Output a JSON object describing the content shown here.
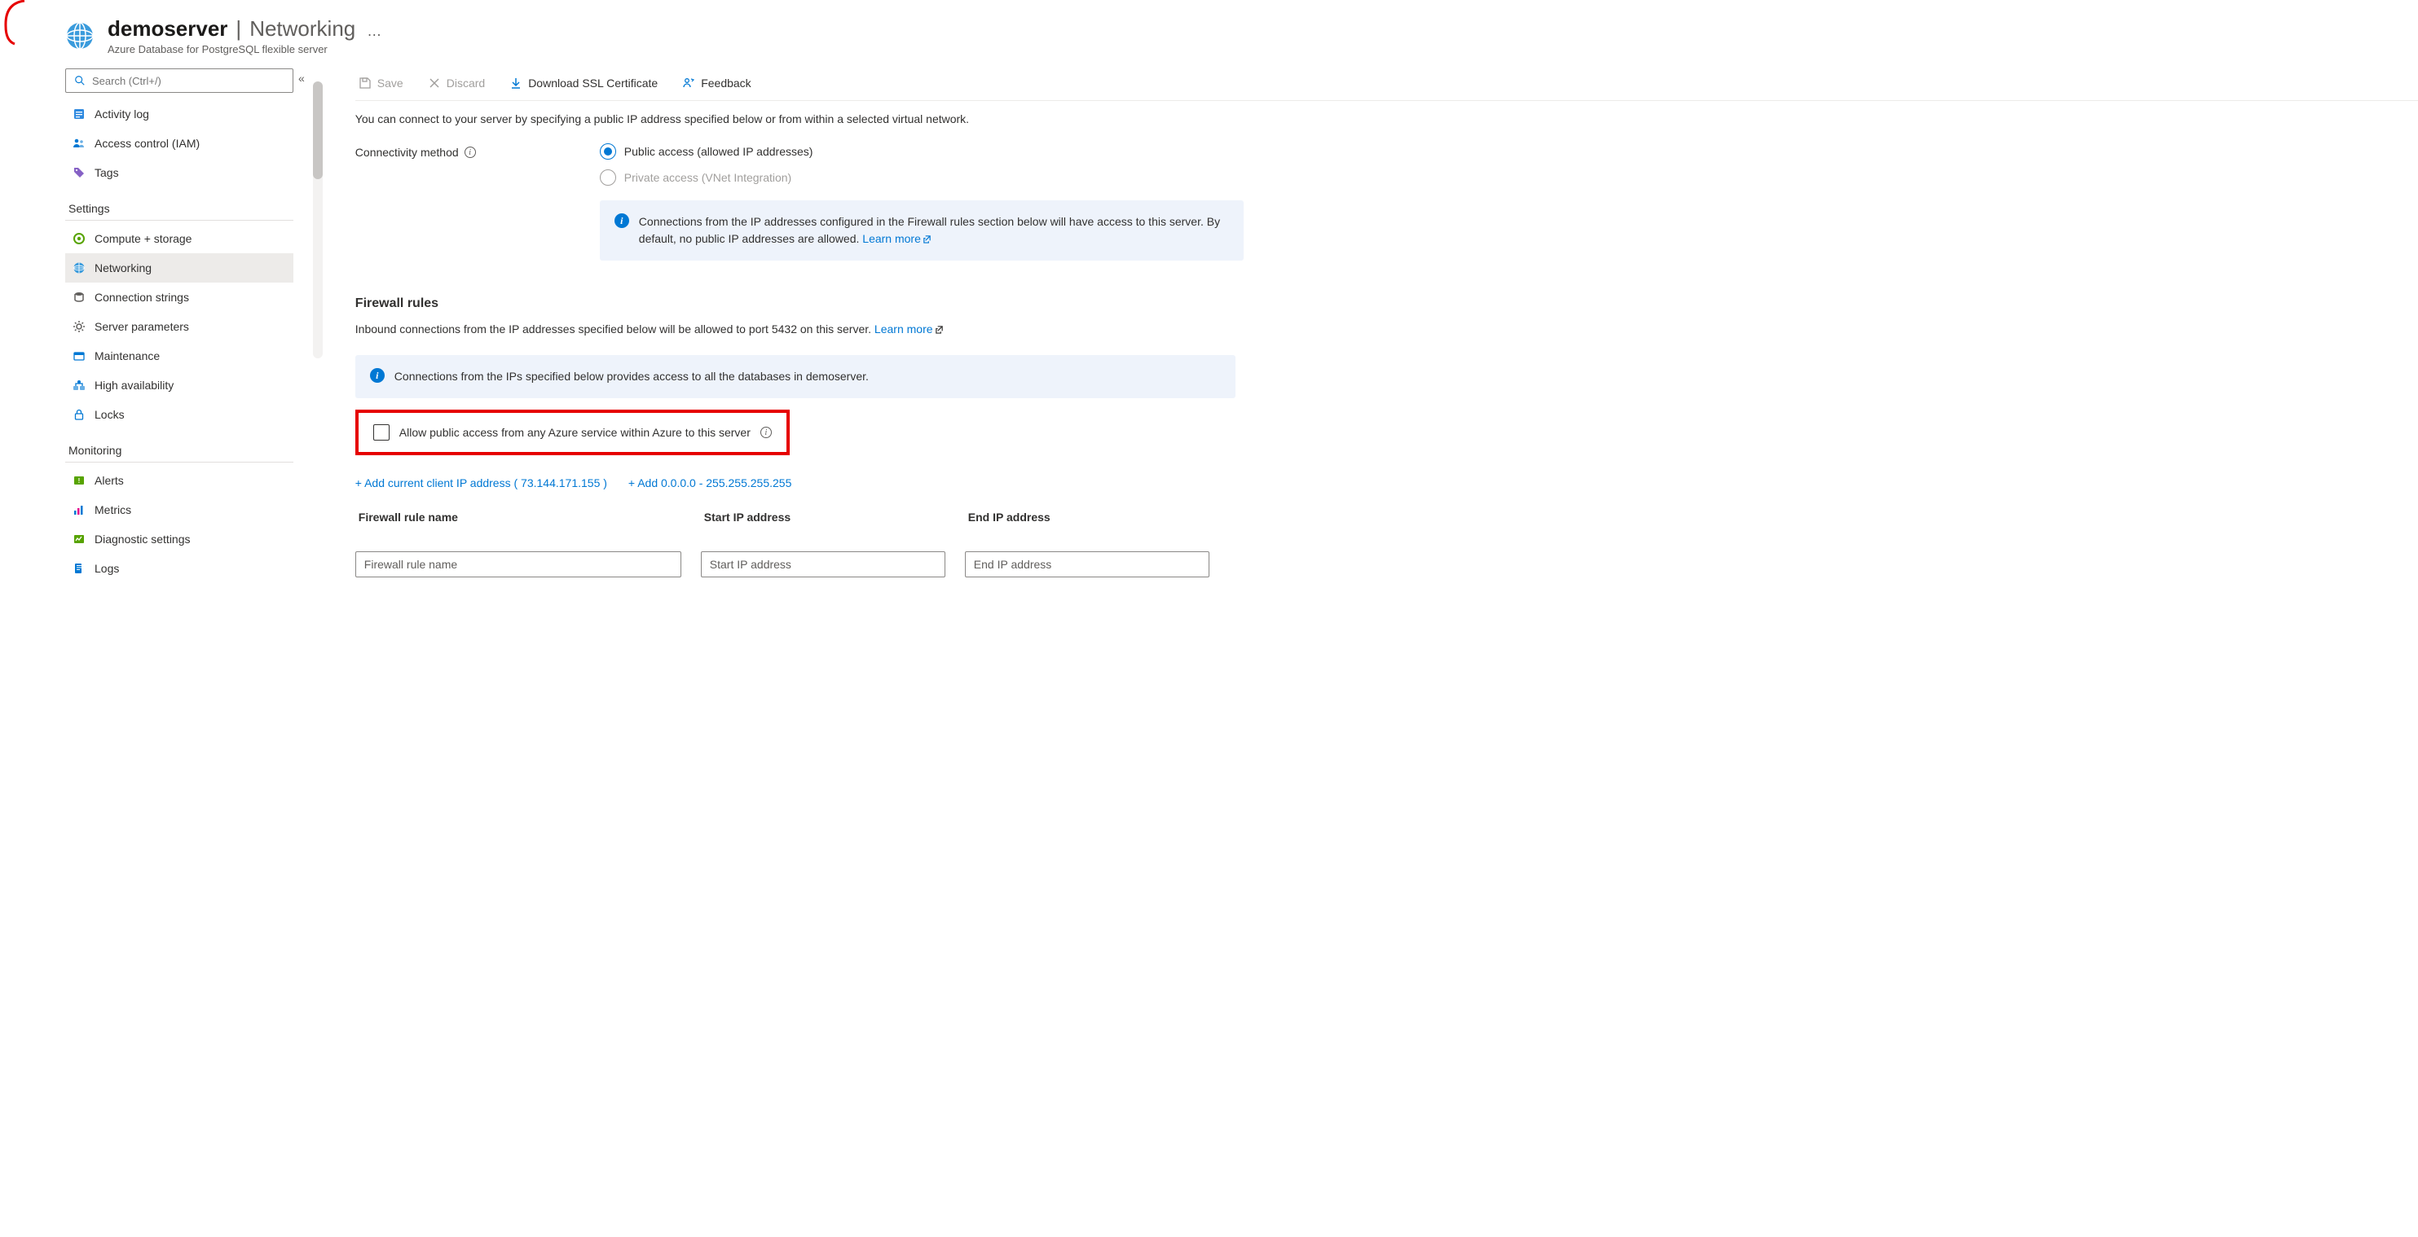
{
  "header": {
    "resource_name": "demoserver",
    "blade_name": "Networking",
    "ellipsis": "…",
    "subtype": "Azure Database for PostgreSQL flexible server"
  },
  "sidebar": {
    "search_placeholder": "Search (Ctrl+/)",
    "top_items": [
      {
        "key": "activity-log",
        "label": "Activity log"
      },
      {
        "key": "access-control",
        "label": "Access control (IAM)"
      },
      {
        "key": "tags",
        "label": "Tags"
      }
    ],
    "settings_group": "Settings",
    "settings_items": [
      {
        "key": "compute-storage",
        "label": "Compute + storage"
      },
      {
        "key": "networking",
        "label": "Networking"
      },
      {
        "key": "connection-strings",
        "label": "Connection strings"
      },
      {
        "key": "server-parameters",
        "label": "Server parameters"
      },
      {
        "key": "maintenance",
        "label": "Maintenance"
      },
      {
        "key": "high-availability",
        "label": "High availability"
      },
      {
        "key": "locks",
        "label": "Locks"
      }
    ],
    "monitoring_group": "Monitoring",
    "monitoring_items": [
      {
        "key": "alerts",
        "label": "Alerts"
      },
      {
        "key": "metrics",
        "label": "Metrics"
      },
      {
        "key": "diagnostic-settings",
        "label": "Diagnostic settings"
      },
      {
        "key": "logs",
        "label": "Logs"
      }
    ]
  },
  "toolbar": {
    "save": "Save",
    "discard": "Discard",
    "download_ssl": "Download SSL Certificate",
    "feedback": "Feedback"
  },
  "content": {
    "lead": "You can connect to your server by specifying a public IP address specified below or from within a selected virtual network.",
    "connectivity_label": "Connectivity method",
    "radio_public": "Public access (allowed IP addresses)",
    "radio_private": "Private access (VNet Integration)",
    "banner1_text": "Connections from the IP addresses configured in the Firewall rules section below will have access to this server. By default, no public IP addresses are allowed. ",
    "learn_more": "Learn more",
    "firewall_head": "Firewall rules",
    "firewall_lead_a": "Inbound connections from the IP addresses specified below will be allowed to port 5432 on this server. ",
    "banner2_text": "Connections from the IPs specified below provides access to all the databases in demoserver.",
    "allow_azure_label": "Allow public access from any Azure service within Azure to this server",
    "add_client_ip": "+ Add current client IP address ( 73.144.171.155 )",
    "add_range": "+ Add 0.0.0.0 - 255.255.255.255",
    "col_name": "Firewall rule name",
    "col_start": "Start IP address",
    "col_end": "End IP address",
    "ph_name": "Firewall rule name",
    "ph_start": "Start IP address",
    "ph_end": "End IP address"
  }
}
